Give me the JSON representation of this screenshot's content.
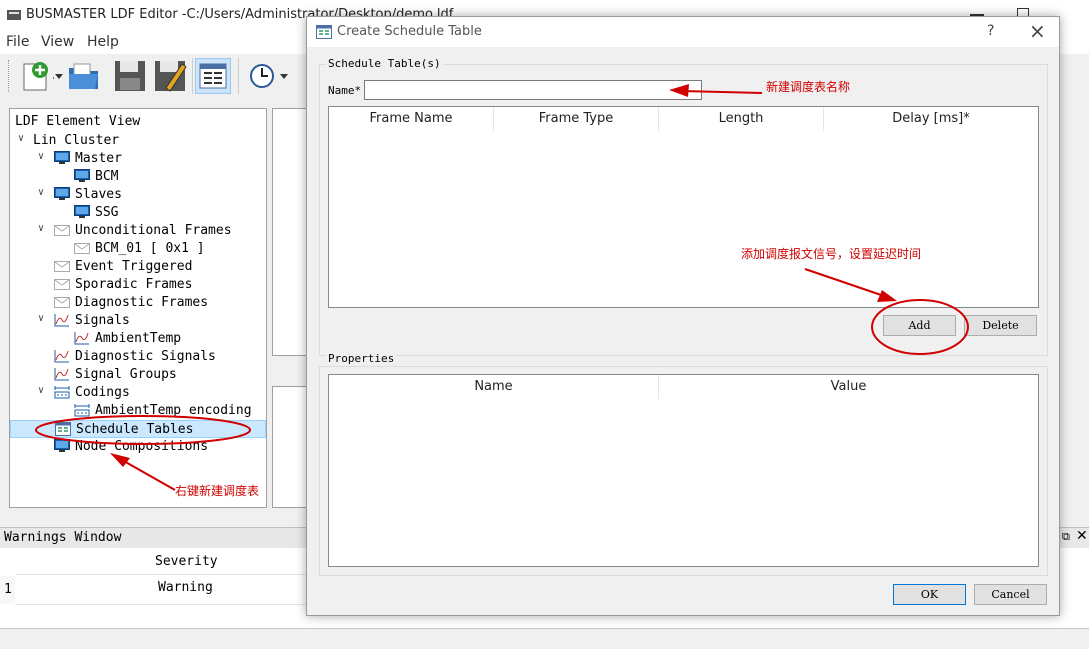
{
  "window": {
    "title": "BUSMASTER LDF Editor -C:/Users/Administrator/Desktop/demo.ldf"
  },
  "menu": [
    "File",
    "View",
    "Help"
  ],
  "toolbar": {
    "icons": [
      "new-icon",
      "open-icon",
      "save-icon",
      "save-as-icon",
      "schedule-table-icon",
      "clock-icon"
    ]
  },
  "tree": {
    "header": "LDF Element View",
    "items": [
      {
        "label": "Lin Cluster",
        "icon": "",
        "expanded": true
      },
      {
        "label": "Master",
        "icon": "monitor-icon",
        "expanded": true
      },
      {
        "label": "BCM",
        "icon": "monitor-icon"
      },
      {
        "label": "Slaves",
        "icon": "monitor-icon",
        "expanded": true
      },
      {
        "label": "SSG",
        "icon": "monitor-icon"
      },
      {
        "label": "Unconditional Frames",
        "icon": "envelope-icon",
        "expanded": true
      },
      {
        "label": "BCM_01 [ 0x1 ]",
        "icon": "envelope-icon"
      },
      {
        "label": "Event Triggered",
        "icon": "envelope-icon"
      },
      {
        "label": "Sporadic Frames",
        "icon": "envelope-icon"
      },
      {
        "label": "Diagnostic Frames",
        "icon": "envelope-icon"
      },
      {
        "label": "Signals",
        "icon": "signal-icon",
        "expanded": true
      },
      {
        "label": "AmbientTemp",
        "icon": "signal-icon"
      },
      {
        "label": "Diagnostic Signals",
        "icon": "signal-icon"
      },
      {
        "label": "Signal Groups",
        "icon": "signal-icon"
      },
      {
        "label": "Codings",
        "icon": "coding-icon",
        "expanded": true
      },
      {
        "label": "AmbientTemp_encoding",
        "icon": "coding-icon"
      },
      {
        "label": "Schedule Tables",
        "icon": "schedule-icon",
        "selected": true
      },
      {
        "label": "Node Compositions",
        "icon": "monitor-icon"
      }
    ]
  },
  "warnings": {
    "title": "Warnings Window",
    "column_header": "Severity",
    "rows": [
      {
        "index": "1",
        "severity": "Warning"
      }
    ]
  },
  "dialog": {
    "title": "Create Schedule Table",
    "help_label": "?",
    "close_label": "×",
    "schedule_group_label": "Schedule Table(s)",
    "name_label": "Name*",
    "name_value": "",
    "columns": [
      "Frame Name",
      "Frame Type",
      "Length",
      "Delay [ms]*"
    ],
    "add_label": "Add",
    "delete_label": "Delete",
    "properties_label": "Properties",
    "prop_columns": [
      "Name",
      "Value"
    ],
    "ok_label": "OK",
    "cancel_label": "Cancel"
  },
  "annotations": {
    "name_note": "新建调度表名称",
    "add_note": "添加调度报文信号，设置延迟时间",
    "tree_note": "右键新建调度表",
    "color": "#d00000"
  },
  "colors": {
    "selection": "#cce8ff",
    "dialog_bg": "#f0f0f0",
    "default_button_border": "#0078d7"
  }
}
